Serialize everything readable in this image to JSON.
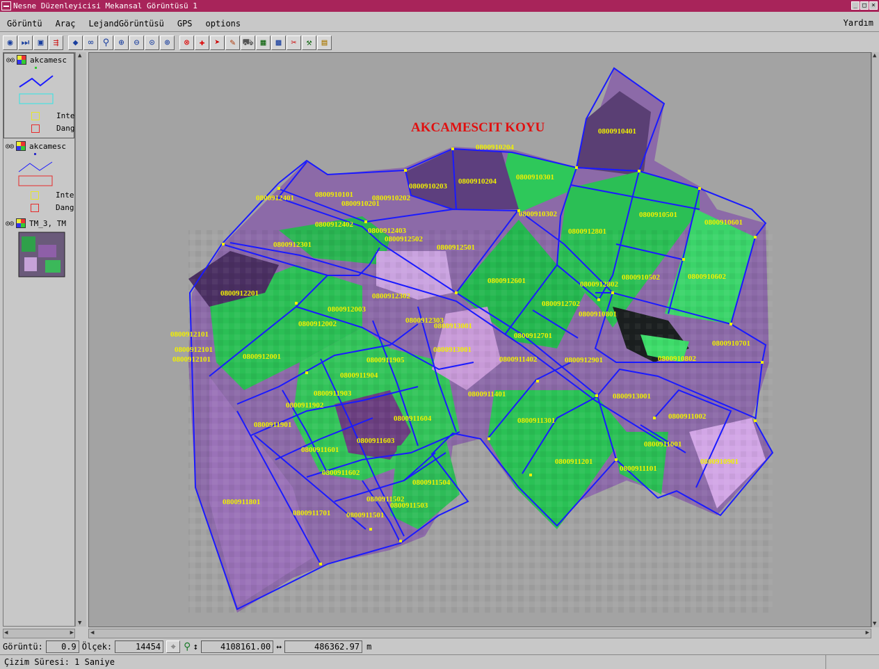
{
  "window": {
    "title": "Nesne Düzenleyicisi Mekansal Görüntüsü 1"
  },
  "menu": {
    "items": [
      "Görüntü",
      "Araç",
      "LejandGörüntüsü",
      "GPS",
      "options"
    ],
    "help": "Yardım"
  },
  "toolbar": {
    "icons": [
      "globe-icon",
      "fast-forward-icon",
      "frame-icon",
      "layers-add-icon",
      "diamond-icon",
      "binoculars-icon",
      "binoculars-search-icon",
      "zoom-in-icon",
      "zoom-out-icon",
      "zoom-actual-icon",
      "zoom-fit-icon",
      "zoom-red-icon",
      "axis-icon",
      "pointer-icon",
      "edit-icon",
      "car-icon",
      "map-icon",
      "grid-icon",
      "scissors-icon",
      "tools-icon",
      "table-icon"
    ]
  },
  "legend": {
    "layers": [
      {
        "name": "akcamesc",
        "symbols": [
          {
            "color": "#e6e62a",
            "label": "Inte"
          },
          {
            "color": "#e62a2a",
            "label": "Dang"
          }
        ]
      },
      {
        "name": "akcamesc",
        "symbols": [
          {
            "color": "#e6e62a",
            "label": "Inte"
          },
          {
            "color": "#e62a2a",
            "label": "Dang"
          }
        ]
      },
      {
        "name": "TM_3, TM"
      }
    ]
  },
  "map": {
    "title": "AKCAMESCIT KOYU",
    "title_color": "#e01010",
    "label_color": "#f0f000",
    "line_color": "#1a1aff",
    "parcel_labels": [
      "0800910204",
      "0800910401",
      "0800910301",
      "0800910204",
      "0800910203",
      "0800910101",
      "0800910202",
      "0800910201",
      "0800912401",
      "0800910302",
      "0800910501",
      "0800910601",
      "0800912402",
      "0800912403",
      "0800912502",
      "0800912801",
      "0800912301",
      "0800912501",
      "0800912601",
      "0800910502",
      "0800910602",
      "0800912802",
      "0800912201",
      "0800912302",
      "0800912702",
      "0800910801",
      "0800912003",
      "0800912303",
      "0800913001",
      "0800912002",
      "0800912701",
      "0800910701",
      "0800912101",
      "0800912101",
      "0800912101",
      "0800912001",
      "0800913001",
      "0800911905",
      "0800911402",
      "0800912901",
      "0800910802",
      "0800911904",
      "0800911903",
      "0800911401",
      "0800913001",
      "0800911902",
      "0800911604",
      "0800911301",
      "0800911002",
      "0800911901",
      "0800911603",
      "0800911001",
      "0800911601",
      "0800911201",
      "0800910901",
      "0800911602",
      "0800911101",
      "0800911504",
      "0800911801",
      "0800911502",
      "0800911503",
      "0800911701",
      "0800911501"
    ]
  },
  "status": {
    "view_label": "Görüntü:",
    "view_value": "0.9",
    "scale_label": "Ölçek:",
    "scale_value": "14454",
    "coord_y": "4108161.00",
    "coord_x": "486362.97",
    "unit": "m",
    "message": "Çizim Süresi: 1 Saniye"
  }
}
